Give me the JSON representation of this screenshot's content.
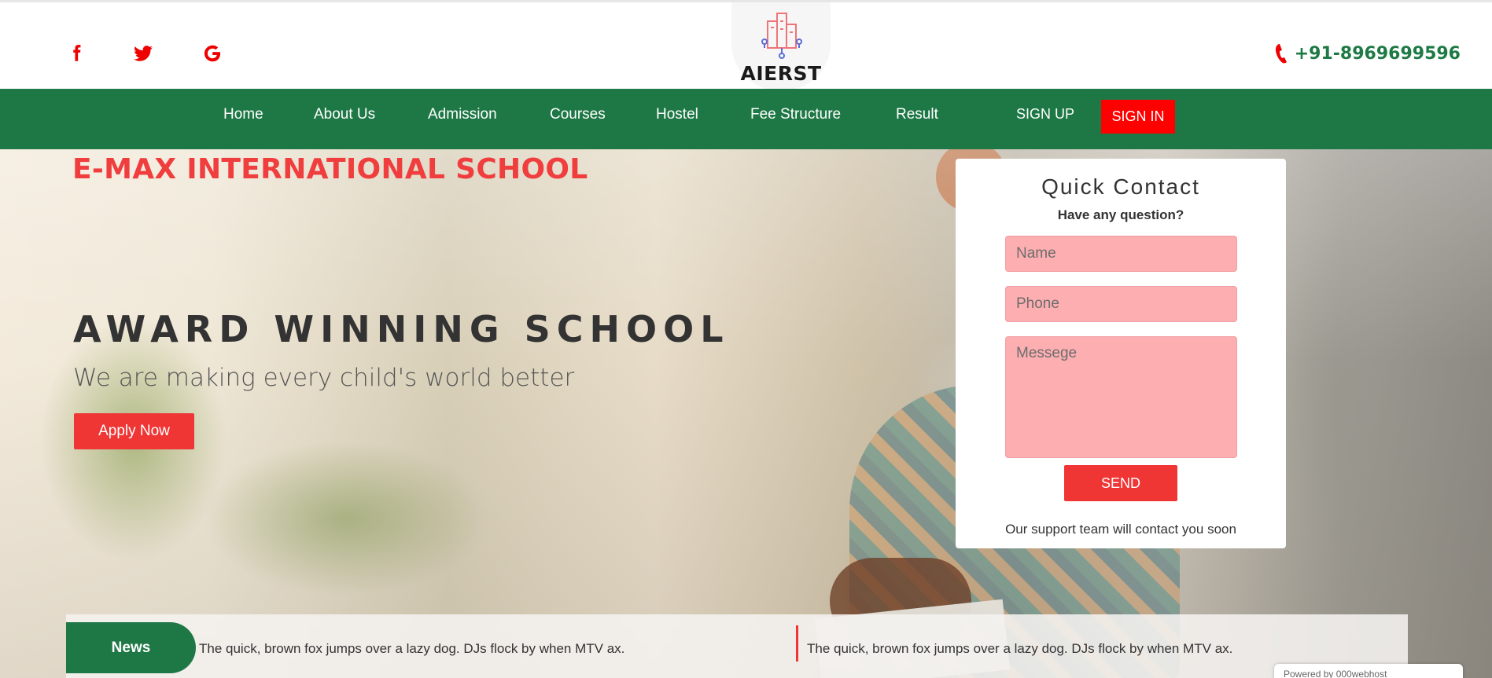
{
  "header": {
    "social": [
      {
        "name": "facebook-icon",
        "glyph": "f"
      },
      {
        "name": "twitter-icon",
        "glyph": "twitter"
      },
      {
        "name": "google-icon",
        "glyph": "G"
      }
    ],
    "logo_text": "AIERST",
    "phone": "+91-8969699596"
  },
  "nav": {
    "items": [
      "Home",
      "About Us",
      "Admission",
      "Courses",
      "Hostel",
      "Fee Structure",
      "Result",
      "SIGN UP"
    ],
    "signin": "SIGN IN"
  },
  "hero": {
    "school_name": "E-MAX INTERNATIONAL SCHOOL",
    "title": "AWARD WINNING SCHOOL",
    "subtitle": "We are making every child's world better",
    "apply": "Apply Now"
  },
  "contact": {
    "title": "Quick Contact",
    "question": "Have any question?",
    "name_placeholder": "Name",
    "phone_placeholder": "Phone",
    "message_placeholder": "Messege",
    "send": "SEND",
    "note": "Our support team will contact you soon"
  },
  "news": {
    "label": "News",
    "items": [
      "The quick, brown fox jumps over a lazy dog. DJs flock by when MTV ax.",
      "The quick, brown fox jumps over a lazy dog. DJs flock by when MTV ax."
    ]
  },
  "powered": "Powered by 000webhost",
  "colors": {
    "green": "#1e7845",
    "red": "#f03535",
    "pink_field": "#fdaeb1"
  }
}
